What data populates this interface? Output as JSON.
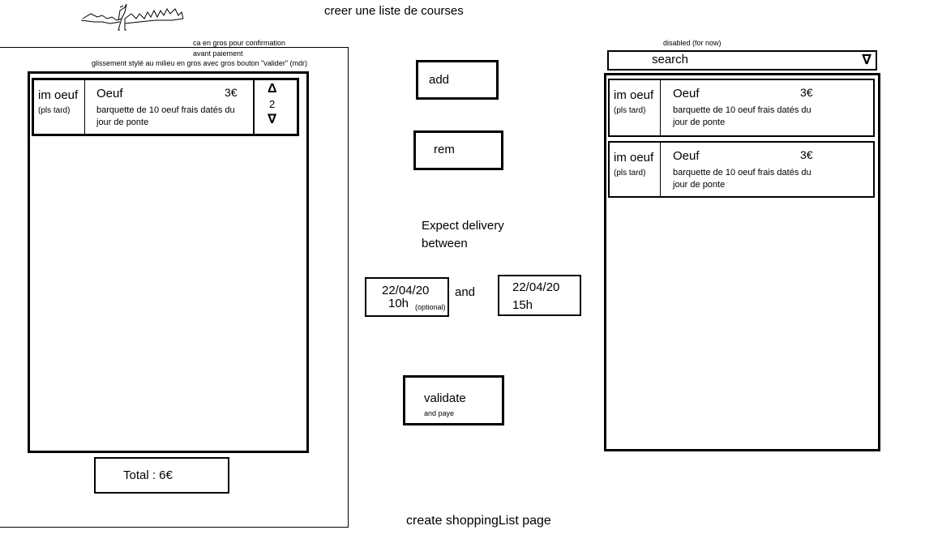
{
  "page_title": "creer une liste de courses",
  "footer_caption": "create shoppingList page",
  "left_panel": {
    "notes": [
      "ca en gros pour confirmation",
      "avant  paiement",
      "glissement stylé au milieu en gros avec gros bouton \"valider\" (mdr)"
    ],
    "items": [
      {
        "image_label": "im oeuf",
        "image_sub": "(pls tard)",
        "name": "Oeuf",
        "price": "3€",
        "description": "barquette de 10 oeuf frais datés du jour de ponte",
        "quantity": "2",
        "up_icon": "Δ",
        "down_icon": "∇"
      }
    ],
    "total": "Total : 6€"
  },
  "middle": {
    "add_label": "add",
    "rem_label": "rem",
    "delivery_line1": "Expect delivery",
    "delivery_line2": "between",
    "date_from_line1": "22/04/20",
    "date_from_line2": "10h",
    "optional_note": "(optional)",
    "and_label": "and",
    "date_to_line1": "22/04/20",
    "date_to_line2": "15h",
    "validate_label": "validate",
    "validate_sub": "and paye"
  },
  "right_panel": {
    "search_note": "disabled (for now)",
    "search_label": "search",
    "search_arrow": "∇",
    "items": [
      {
        "image_label": "im oeuf",
        "image_sub": "(pls tard)",
        "name": "Oeuf",
        "price": "3€",
        "description": "barquette de 10 oeuf frais datés du jour de ponte"
      },
      {
        "image_label": "im oeuf",
        "image_sub": "(pls tard)",
        "name": "Oeuf",
        "price": "3€",
        "description": "barquette de 10 oeuf frais datés du jour de ponte"
      }
    ]
  }
}
